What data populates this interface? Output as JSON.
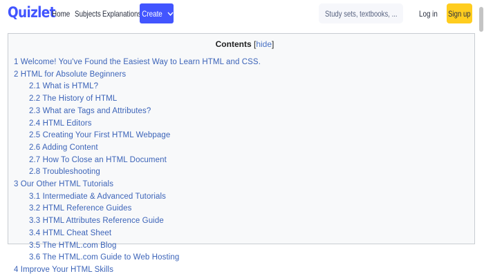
{
  "header": {
    "logo": "Quizlet",
    "nav": [
      "Home",
      "Subjects",
      "Explanations"
    ],
    "create_label": "Create",
    "search_placeholder": "Study sets, textbooks, ...",
    "login_label": "Log in",
    "signup_label": "Sign up"
  },
  "colors": {
    "brand": "#4255ff",
    "signup": "#ffcd1f",
    "link": "#3b63b8"
  },
  "toc": {
    "title": "Contents",
    "hide_label": "hide",
    "items": [
      {
        "text": "1 Welcome! You've Found the Easiest Way to Learn HTML and CSS.",
        "level": 1
      },
      {
        "text": "2 HTML for Absolute Beginners",
        "level": 1
      },
      {
        "text": "2.1 What is HTML?",
        "level": 2
      },
      {
        "text": "2.2 The History of HTML",
        "level": 2
      },
      {
        "text": "2.3 What are Tags and Attributes?",
        "level": 2
      },
      {
        "text": "2.4 HTML Editors",
        "level": 2
      },
      {
        "text": "2.5 Creating Your First HTML Webpage",
        "level": 2
      },
      {
        "text": "2.6 Adding Content",
        "level": 2
      },
      {
        "text": "2.7 How To Close an HTML Document",
        "level": 2
      },
      {
        "text": "2.8 Troubleshooting",
        "level": 2
      },
      {
        "text": "3 Our Other HTML Tutorials",
        "level": 1
      },
      {
        "text": "3.1 Intermediate & Advanced Tutorials",
        "level": 2
      },
      {
        "text": "3.2 HTML Reference Guides",
        "level": 2
      },
      {
        "text": "3.3 HTML Attributes Reference Guide",
        "level": 2
      },
      {
        "text": "3.4 HTML Cheat Sheet",
        "level": 2
      },
      {
        "text": "3.5 The HTML.com Blog",
        "level": 2
      },
      {
        "text": "3.6 The HTML.com Guide to Web Hosting",
        "level": 2
      },
      {
        "text": "4 Improve Your HTML Skills",
        "level": 1
      }
    ]
  }
}
